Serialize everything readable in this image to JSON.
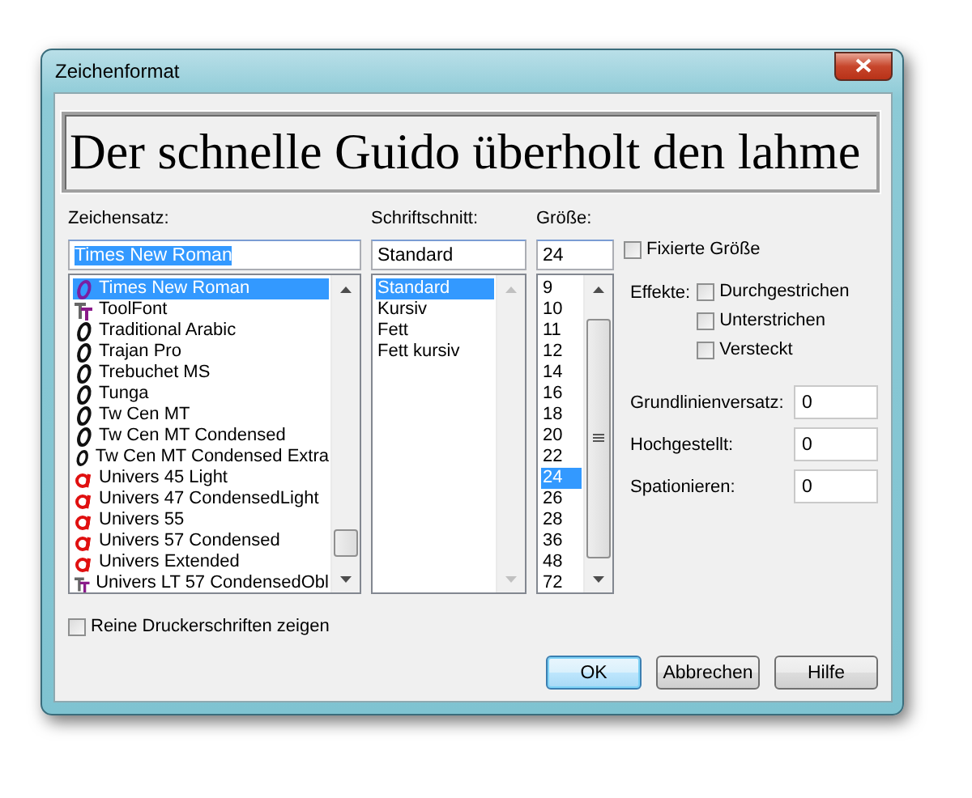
{
  "window": {
    "title": "Zeichenformat"
  },
  "preview": {
    "text": "Der schnelle Guido überholt den lahme"
  },
  "font": {
    "label": "Zeichensatz:",
    "value": "Times New Roman",
    "text_selected": true,
    "items": [
      {
        "name": "Times New Roman",
        "kind": "opentype",
        "selected": true
      },
      {
        "name": "ToolFont",
        "kind": "truetype",
        "selected": false
      },
      {
        "name": "Traditional Arabic",
        "kind": "opentype",
        "selected": false
      },
      {
        "name": "Trajan Pro",
        "kind": "opentype",
        "selected": false
      },
      {
        "name": "Trebuchet MS",
        "kind": "opentype",
        "selected": false
      },
      {
        "name": "Tunga",
        "kind": "opentype",
        "selected": false
      },
      {
        "name": "Tw Cen MT",
        "kind": "opentype",
        "selected": false
      },
      {
        "name": "Tw Cen MT Condensed",
        "kind": "opentype",
        "selected": false
      },
      {
        "name": "Tw Cen MT Condensed Extra",
        "kind": "opentype",
        "selected": false
      },
      {
        "name": "Univers 45 Light",
        "kind": "type1",
        "selected": false
      },
      {
        "name": "Univers 47 CondensedLight",
        "kind": "type1",
        "selected": false
      },
      {
        "name": "Univers 55",
        "kind": "type1",
        "selected": false
      },
      {
        "name": "Univers 57 Condensed",
        "kind": "type1",
        "selected": false
      },
      {
        "name": "Univers Extended",
        "kind": "type1",
        "selected": false
      },
      {
        "name": "Univers LT 57 CondensedObl",
        "kind": "truetype",
        "selected": false
      }
    ]
  },
  "style": {
    "label": "Schriftschnitt:",
    "value": "Standard",
    "scrollbar_disabled": true,
    "items": [
      {
        "name": "Standard",
        "selected": true
      },
      {
        "name": "Kursiv",
        "selected": false
      },
      {
        "name": "Fett",
        "selected": false
      },
      {
        "name": "Fett kursiv",
        "selected": false
      }
    ]
  },
  "size": {
    "label": "Größe:",
    "value": "24",
    "scrollbar_disabled": false,
    "items": [
      {
        "name": "9",
        "selected": false
      },
      {
        "name": "10",
        "selected": false
      },
      {
        "name": "11",
        "selected": false
      },
      {
        "name": "12",
        "selected": false
      },
      {
        "name": "14",
        "selected": false
      },
      {
        "name": "16",
        "selected": false
      },
      {
        "name": "18",
        "selected": false
      },
      {
        "name": "20",
        "selected": false
      },
      {
        "name": "22",
        "selected": false
      },
      {
        "name": "24",
        "selected": true
      },
      {
        "name": "26",
        "selected": false
      },
      {
        "name": "28",
        "selected": false
      },
      {
        "name": "36",
        "selected": false
      },
      {
        "name": "48",
        "selected": false
      },
      {
        "name": "72",
        "selected": false
      }
    ]
  },
  "fixed_size": {
    "label": "Fixierte Größe",
    "checked": false
  },
  "effects": {
    "label": "Effekte:",
    "options": [
      {
        "label": "Durchgestrichen",
        "checked": false
      },
      {
        "label": "Unterstrichen",
        "checked": false
      },
      {
        "label": "Versteckt",
        "checked": false
      }
    ]
  },
  "offsets": [
    {
      "label": "Grundlinienversatz:",
      "value": "0"
    },
    {
      "label": "Hochgestellt:",
      "value": "0"
    },
    {
      "label": "Spationieren:",
      "value": "0"
    }
  ],
  "printer_fonts": {
    "label": "Reine Druckerschriften zeigen",
    "checked": false
  },
  "buttons": [
    {
      "label": "OK",
      "default": true
    },
    {
      "label": "Abbrechen",
      "default": false
    },
    {
      "label": "Hilfe",
      "default": false
    }
  ]
}
